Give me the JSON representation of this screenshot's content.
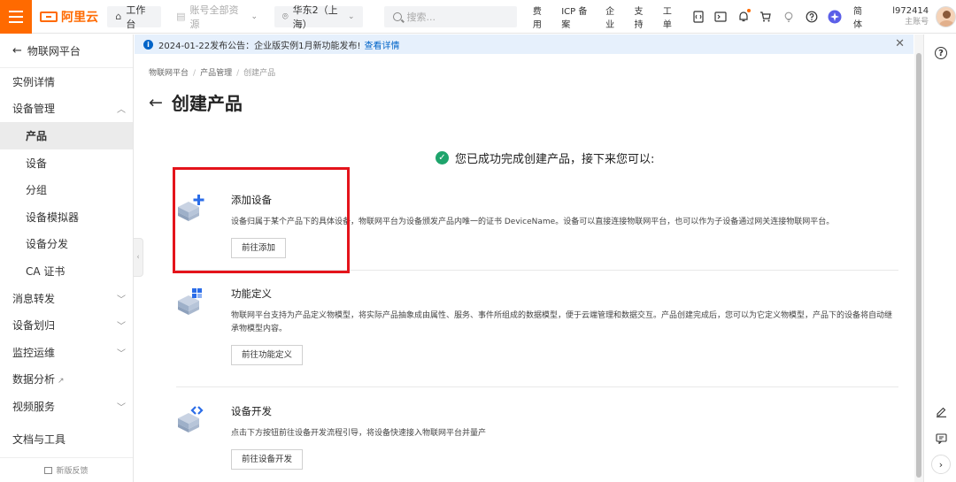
{
  "topbar": {
    "logo": "阿里云",
    "workbench": "工作台",
    "account_resources": "账号全部资源",
    "region": "华东2（上海）",
    "search_placeholder": "搜索...",
    "links": [
      "费用",
      "ICP 备案",
      "企业",
      "支持",
      "工单"
    ],
    "language": "简体",
    "user_name": "l972414",
    "user_role": "主账号"
  },
  "sidebar": {
    "header": "物联网平台",
    "items": [
      {
        "label": "实例详情",
        "sub": false,
        "caret": "",
        "active": false
      },
      {
        "label": "设备管理",
        "sub": false,
        "caret": "up",
        "active": false
      },
      {
        "label": "产品",
        "sub": true,
        "caret": "",
        "active": true
      },
      {
        "label": "设备",
        "sub": true,
        "caret": "",
        "active": false
      },
      {
        "label": "分组",
        "sub": true,
        "caret": "",
        "active": false
      },
      {
        "label": "设备模拟器",
        "sub": true,
        "caret": "",
        "active": false
      },
      {
        "label": "设备分发",
        "sub": true,
        "caret": "",
        "active": false
      },
      {
        "label": "CA 证书",
        "sub": true,
        "caret": "",
        "active": false
      },
      {
        "label": "消息转发",
        "sub": false,
        "caret": "down",
        "active": false
      },
      {
        "label": "设备划归",
        "sub": false,
        "caret": "down",
        "active": false
      },
      {
        "label": "监控运维",
        "sub": false,
        "caret": "down",
        "active": false
      },
      {
        "label": "数据分析",
        "sub": false,
        "caret": "",
        "active": false,
        "external": true
      },
      {
        "label": "视频服务",
        "sub": false,
        "caret": "down",
        "active": false
      },
      {
        "label": "文档与工具",
        "sub": false,
        "caret": "",
        "active": false,
        "gap": true
      }
    ],
    "feedback": "新版反馈"
  },
  "announcement": {
    "text": "2024-01-22发布公告：企业版实例1月新功能发布!",
    "link": "查看详情"
  },
  "breadcrumb": [
    "物联网平台",
    "产品管理",
    "创建产品"
  ],
  "page_title": "创建产品",
  "success_message": "您已成功完成创建产品，接下来您可以:",
  "steps": [
    {
      "title": "添加设备",
      "desc": "设备归属于某个产品下的具体设备，物联网平台为设备颁发产品内唯一的证书 DeviceName。设备可以直接连接物联网平台，也可以作为子设备通过网关连接物联网平台。",
      "button": "前往添加",
      "icon": "add-device-icon"
    },
    {
      "title": "功能定义",
      "desc": "物联网平台支持为产品定义物模型，将实际产品抽象成由属性、服务、事件所组成的数据模型，便于云端管理和数据交互。产品创建完成后，您可以为它定义物模型，产品下的设备将自动继承物模型内容。",
      "button": "前往功能定义",
      "icon": "function-definition-icon"
    },
    {
      "title": "设备开发",
      "desc": "点击下方按钮前往设备开发流程引导，将设备快速接入物联网平台并量产",
      "button": "前往设备开发",
      "icon": "device-development-icon"
    }
  ],
  "colors": {
    "brand": "#ff6a00",
    "link": "#0064c8",
    "success": "#1ea46c",
    "highlight": "#e4141b"
  }
}
